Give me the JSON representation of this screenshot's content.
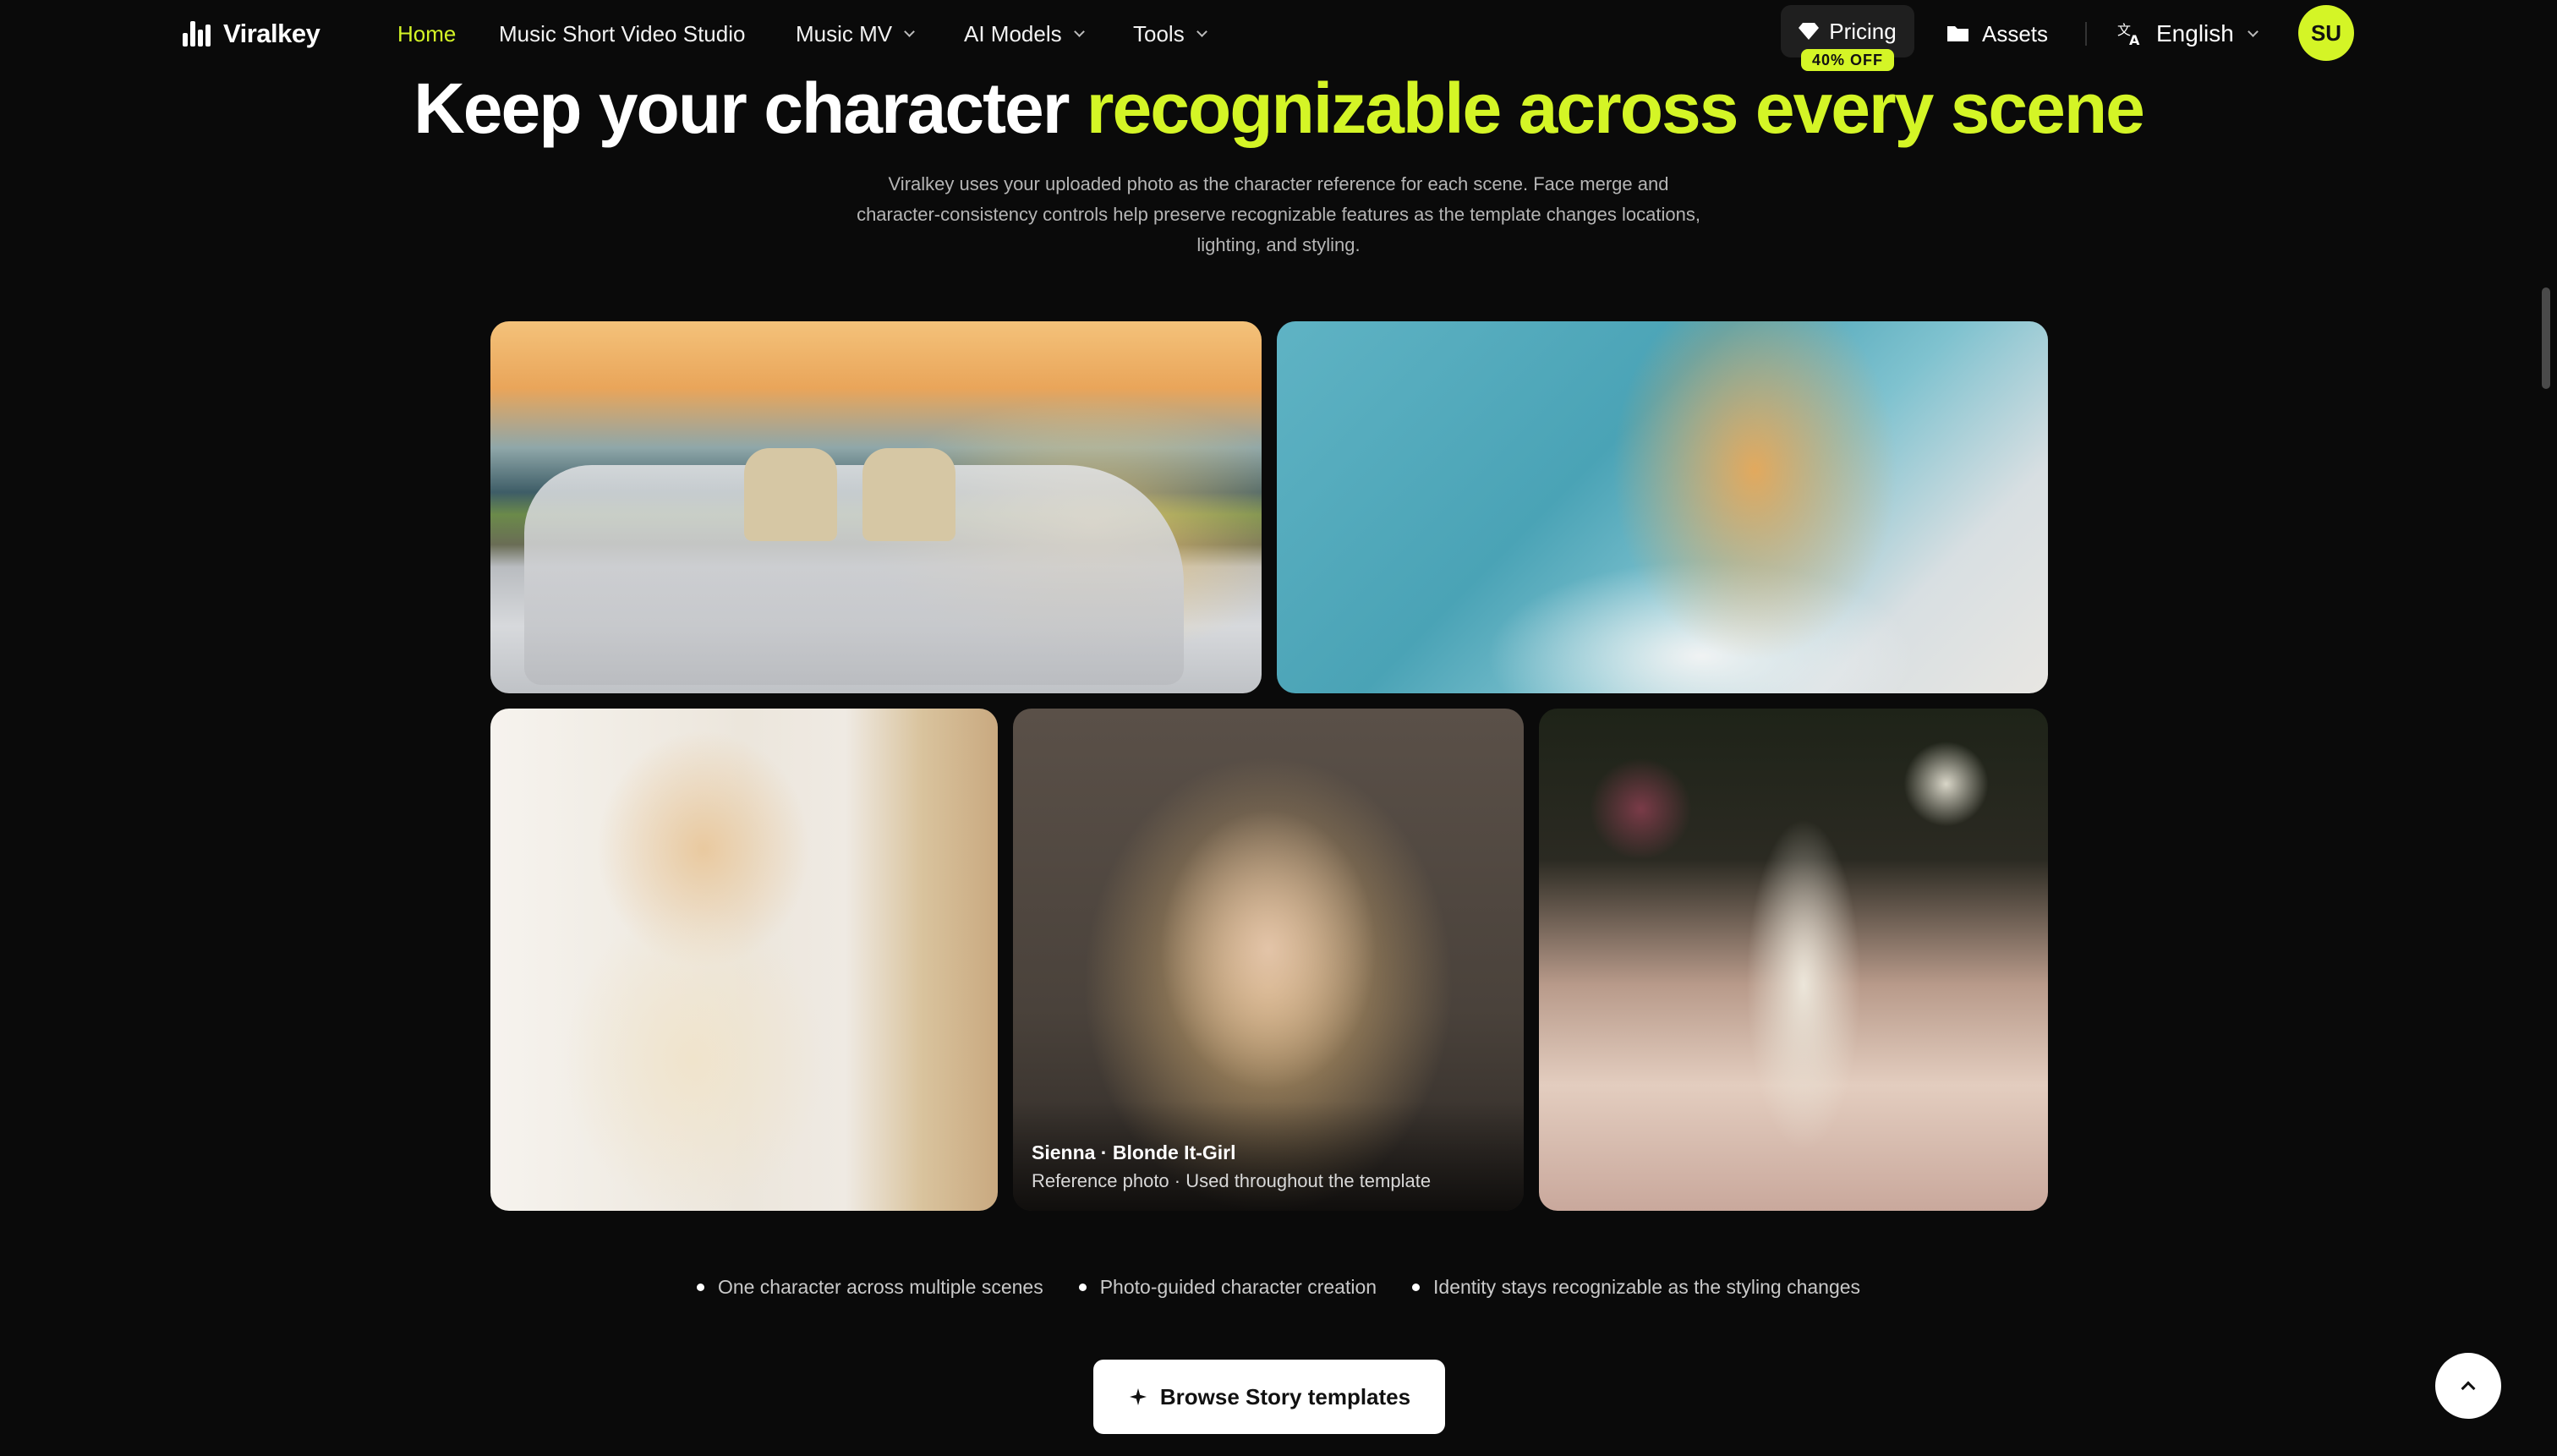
{
  "brand": {
    "name": "Viralkey",
    "accent_color": "#d4f526"
  },
  "nav": {
    "items": [
      {
        "label": "Home",
        "active": true
      },
      {
        "label": "Music Short Video Studio"
      },
      {
        "label": "Music MV",
        "dropdown": true
      },
      {
        "label": "AI Models",
        "dropdown": true
      },
      {
        "label": "Tools",
        "dropdown": true
      }
    ],
    "pricing_label": "Pricing",
    "pricing_badge": "40% OFF",
    "assets_label": "Assets",
    "language": "English",
    "avatar_initials": "SU"
  },
  "hero": {
    "headline_main": "Keep your character",
    "headline_accent": "recognizable across every scene",
    "description": "Viralkey uses your uploaded photo as the character reference for each scene. Face merge and character-consistency controls help preserve recognizable features as the template changes locations, lighting, and styling."
  },
  "gallery": {
    "reference_name": "Sienna · Blonde It-Girl",
    "reference_caption": "Reference photo · Used throughout the template"
  },
  "features": [
    "One character across multiple scenes",
    "Photo-guided character creation",
    "Identity stays recognizable as the styling changes"
  ],
  "cta": {
    "label": "Browse Story templates"
  }
}
